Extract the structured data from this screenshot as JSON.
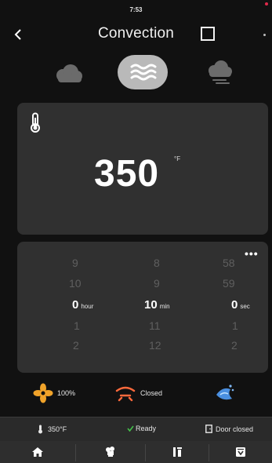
{
  "status": {
    "time": "7:53"
  },
  "header": {
    "title": "Convection",
    "back_icon": "chevron-left-icon"
  },
  "modes": [
    {
      "name": "cloud",
      "icon": "cloud-icon",
      "selected": false
    },
    {
      "name": "convection",
      "icon": "convection-waves-icon",
      "selected": true
    },
    {
      "name": "steam",
      "icon": "cloud-steam-icon",
      "selected": false
    }
  ],
  "temperature": {
    "value": "350",
    "unit": "°F"
  },
  "timer": {
    "hours": {
      "items": [
        "9",
        "10",
        "0",
        "1",
        "2"
      ],
      "unit": "hour"
    },
    "minutes": {
      "items": [
        "8",
        "9",
        "10",
        "11",
        "12"
      ],
      "unit": "min"
    },
    "seconds": {
      "items": [
        "58",
        "59",
        "0",
        "1",
        "2"
      ],
      "unit": "sec"
    },
    "more_label": "•••"
  },
  "controls": {
    "fan": {
      "label": "100%",
      "icon": "fan-icon"
    },
    "damper": {
      "label": "Closed",
      "icon": "damper-icon"
    },
    "spray": {
      "icon": "water-spray-icon"
    }
  },
  "infobar": {
    "temperature": "350°F",
    "status": "Ready",
    "door": "Door closed"
  },
  "nav": [
    "home-icon",
    "chef-icon",
    "settings-icon",
    "cleaning-icon"
  ],
  "colors": {
    "background": "#111111",
    "panel": "#303030",
    "accent_fan": "#f0a32a",
    "accent_damper": "#ff6a3c",
    "accent_spray": "#4a8fe0",
    "ready": "#44c04a"
  }
}
